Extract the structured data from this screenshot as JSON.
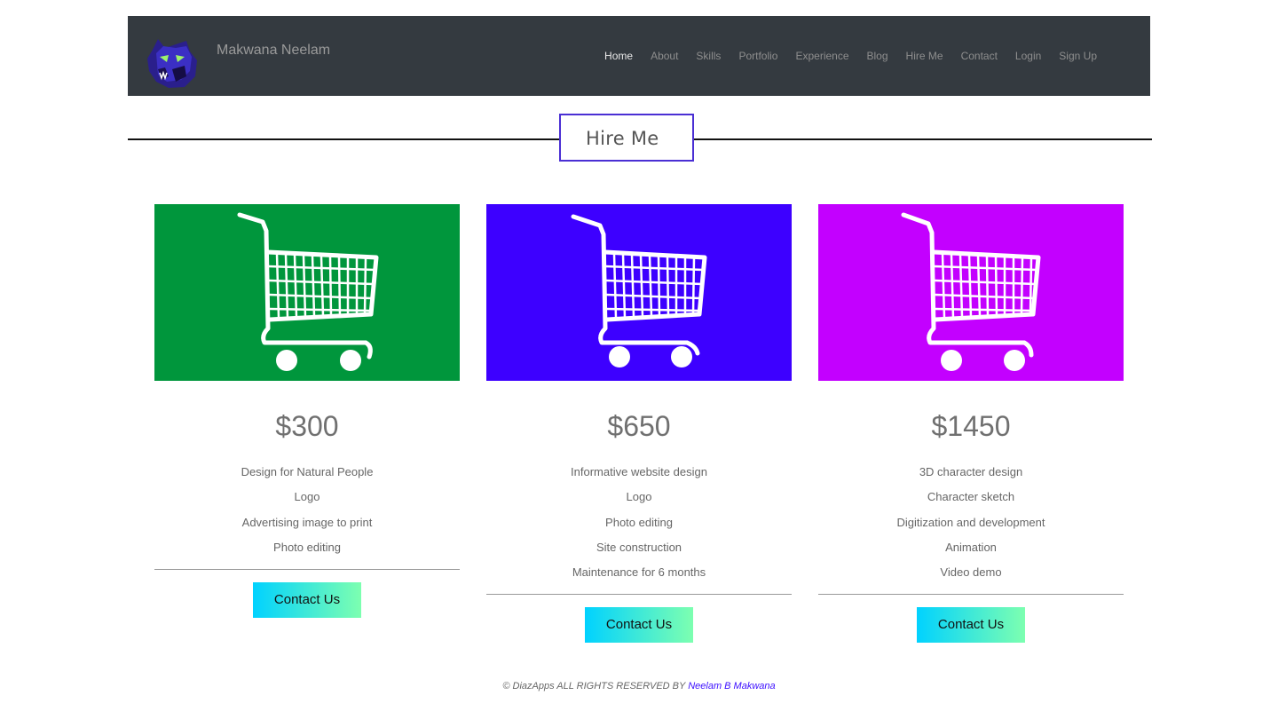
{
  "colors": {
    "navbar_bg": "#343a40",
    "title_border": "#4a2fd4",
    "card1": "#00963c",
    "card2": "#3d00ff",
    "card3": "#c300ff",
    "button_gradient_start": "#00d2ff",
    "button_gradient_end": "#7dffb0",
    "author_link": "#3d10ff"
  },
  "navbar": {
    "brand": "Makwana Neelam",
    "logo_icon": "panther-head-logo",
    "items": [
      {
        "label": "Home",
        "active": true
      },
      {
        "label": "About"
      },
      {
        "label": "Skills"
      },
      {
        "label": "Portfolio"
      },
      {
        "label": "Experience"
      },
      {
        "label": "Blog"
      },
      {
        "label": "Hire Me"
      },
      {
        "label": "Contact"
      },
      {
        "label": "Login"
      },
      {
        "label": "Sign Up"
      }
    ]
  },
  "section": {
    "title": "Hire Me"
  },
  "plans": [
    {
      "color": "#00963c",
      "icon": "shopping-cart-icon",
      "price": "$300",
      "features": [
        "Design for Natural People",
        "Logo",
        "Advertising image to print",
        "Photo editing"
      ],
      "button": "Contact Us"
    },
    {
      "color": "#3d00ff",
      "icon": "shopping-cart-icon",
      "price": "$650",
      "features": [
        "Informative website design",
        "Logo",
        "Photo editing",
        "Site construction",
        "Maintenance for 6 months"
      ],
      "button": "Contact Us"
    },
    {
      "color": "#c300ff",
      "icon": "shopping-cart-icon",
      "price": "$1450",
      "features": [
        "3D character design",
        "Character sketch",
        "Digitization and development",
        "Animation",
        "Video demo"
      ],
      "button": "Contact Us"
    }
  ],
  "footer": {
    "text": "© DiazApps ALL RIGHTS RESERVED BY",
    "author": "Neelam B Makwana"
  }
}
